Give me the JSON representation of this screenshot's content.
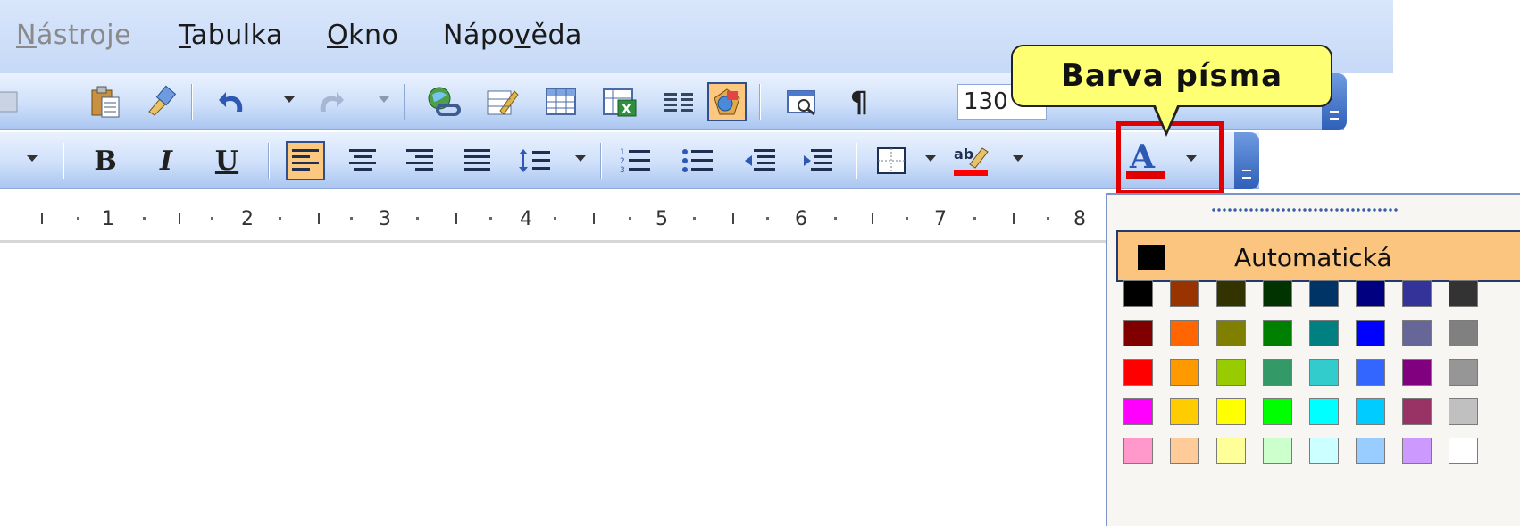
{
  "menu": {
    "items": [
      {
        "text": "Nástroje",
        "key": "N",
        "rest": "ástroje",
        "disabled": true
      },
      {
        "text": "Tabulka",
        "key": "T",
        "rest": "abulka",
        "disabled": false
      },
      {
        "text": "Okno",
        "key": "O",
        "rest": "kno",
        "disabled": false
      },
      {
        "text": "Nápověda",
        "pre": "Nápo",
        "key": "v",
        "rest": "ěda",
        "disabled": false
      }
    ]
  },
  "toolbar_standard": {
    "zoom_value": "130",
    "pilcrow": "¶",
    "icons": [
      "paste-icon",
      "format-painter-icon",
      "undo-icon",
      "redo-icon",
      "hyperlink-icon",
      "tables-borders-icon",
      "insert-table-icon",
      "insert-excel-icon",
      "columns-icon",
      "drawing-icon",
      "document-map-icon",
      "show-hide-icon"
    ]
  },
  "toolbar_formatting": {
    "bold": "B",
    "italic": "I",
    "underline": "U",
    "highlight_label": "ab",
    "font_color_letter": "A",
    "font_color": "#e00000",
    "highlight_color": "#ff0000"
  },
  "ruler": {
    "numbers": [
      "1",
      "2",
      "3",
      "4",
      "5",
      "6",
      "7",
      "8"
    ]
  },
  "callout": {
    "text": "Barva písma"
  },
  "palette": {
    "automatic_label": "Automatická",
    "automatic_color": "#000000",
    "rows": [
      [
        "#000000",
        "#993300",
        "#333300",
        "#003300",
        "#003366",
        "#000080",
        "#333399",
        "#333333"
      ],
      [
        "#800000",
        "#ff6600",
        "#808000",
        "#008000",
        "#008080",
        "#0000ff",
        "#666699",
        "#808080"
      ],
      [
        "#ff0000",
        "#ff9900",
        "#99cc00",
        "#339966",
        "#33cccc",
        "#3366ff",
        "#800080",
        "#969696"
      ],
      [
        "#ff00ff",
        "#ffcc00",
        "#ffff00",
        "#00ff00",
        "#00ffff",
        "#00ccff",
        "#993366",
        "#c0c0c0"
      ],
      [
        "#ff99cc",
        "#ffcc99",
        "#ffff99",
        "#ccffcc",
        "#ccffff",
        "#99ccff",
        "#cc99ff",
        "#ffffff"
      ]
    ]
  }
}
